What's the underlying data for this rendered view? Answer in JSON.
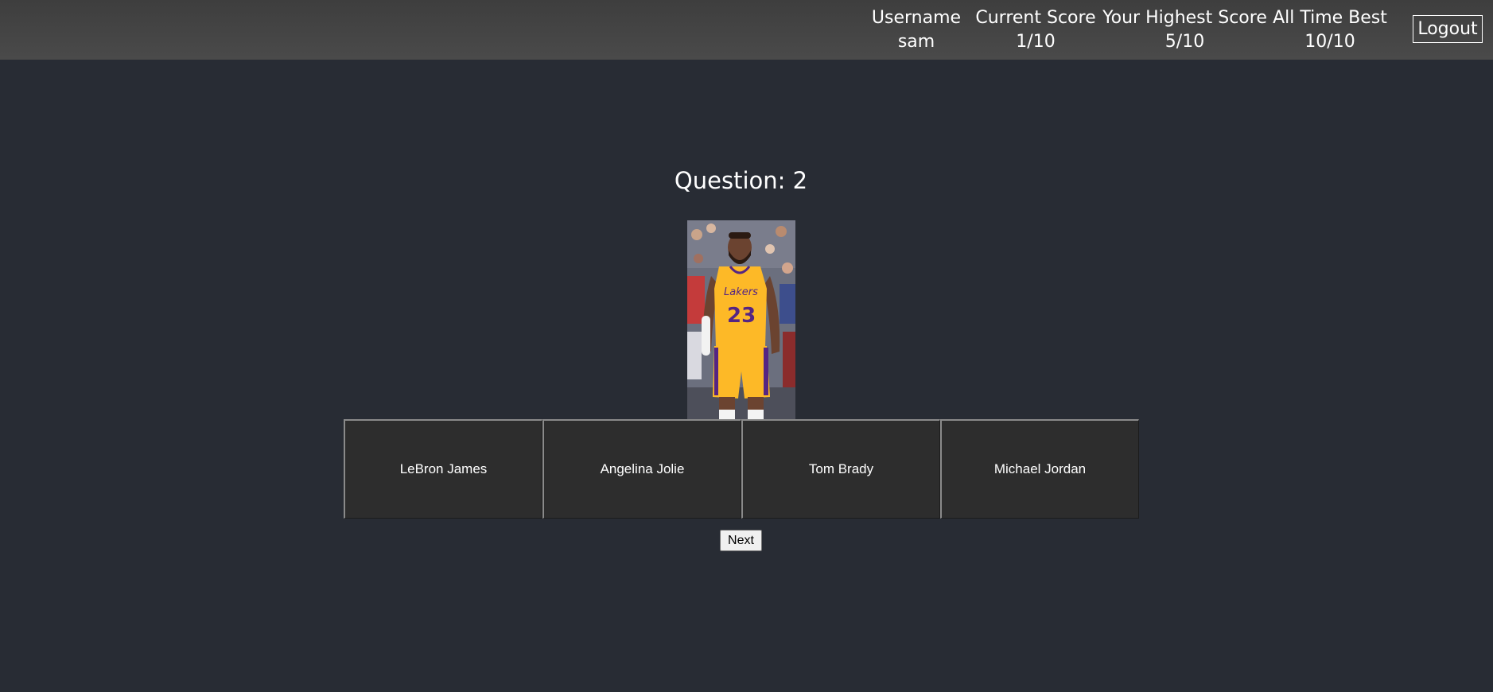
{
  "header": {
    "stats": [
      {
        "label": "Username",
        "value": "sam"
      },
      {
        "label": "Current Score",
        "value": "1/10"
      },
      {
        "label": "Your Highest Score",
        "value": "5/10"
      },
      {
        "label": "All Time Best",
        "value": "10/10"
      }
    ],
    "logout_label": "Logout"
  },
  "question": {
    "title": "Question: 2",
    "image_alt": "LeBron James in Lakers jersey 23",
    "choices": [
      "LeBron James",
      "Angelina Jolie",
      "Tom Brady",
      "Michael Jordan"
    ],
    "next_label": "Next"
  },
  "colors": {
    "page_background": "#282c34",
    "header_background": "#464646",
    "choice_background": "#2d2d2d",
    "jersey_gold": "#fdb927",
    "jersey_purple": "#552583"
  }
}
